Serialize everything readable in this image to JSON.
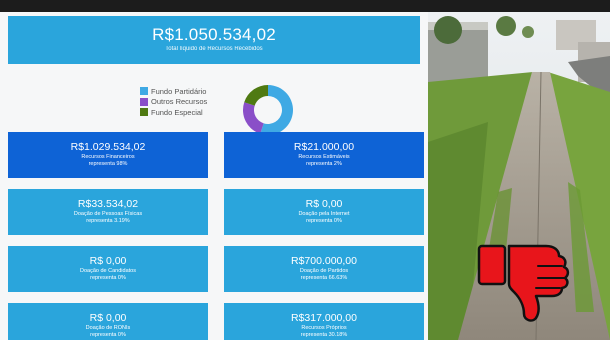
{
  "summary": {
    "total_value": "R$1.050.534,02",
    "total_label": "Total líquido de Recursos Recebidos"
  },
  "legend": {
    "items": [
      {
        "label": "Fundo Partidário",
        "color": "#3fa9e4"
      },
      {
        "label": "Outros Recursos",
        "color": "#8a4fc8"
      },
      {
        "label": "Fundo Especial",
        "color": "#4f7a12"
      }
    ]
  },
  "chart_data": {
    "type": "pie",
    "categories": [
      "Fundo Partidário",
      "Outros Recursos",
      "Fundo Especial"
    ],
    "values": [
      55,
      25,
      20
    ],
    "colors": [
      "#3fa9e4",
      "#8a4fc8",
      "#4f7a12"
    ]
  },
  "cards": [
    {
      "value": "R$1.029.534,02",
      "desc": "Recursos Financeiros",
      "pct": "representa 98%"
    },
    {
      "value": "R$21.000,00",
      "desc": "Recursos Estimáveis",
      "pct": "representa 2%"
    },
    {
      "value": "R$33.534,02",
      "desc": "Doação de Pessoas Físicas",
      "pct": "representa 3.19%"
    },
    {
      "value": "R$ 0,00",
      "desc": "Doação pela Internet",
      "pct": "representa 0%"
    },
    {
      "value": "R$ 0,00",
      "desc": "Doação de Candidatos",
      "pct": "representa 0%"
    },
    {
      "value": "R$700.000,00",
      "desc": "Doação de Partidos",
      "pct": "representa 66.63%"
    },
    {
      "value": "R$ 0,00",
      "desc": "Doação de RONIs",
      "pct": "representa 0%"
    },
    {
      "value": "R$317.000,00",
      "desc": "Recursos Próprios",
      "pct": "representa 30.18%"
    }
  ],
  "colors": {
    "header": "#2aa5dc",
    "card_light": "#2aa5dc",
    "card_dark": "#0e63d6",
    "thumb_red": "#e8151b"
  },
  "icons": {
    "overlay": "thumbs-down-icon"
  }
}
